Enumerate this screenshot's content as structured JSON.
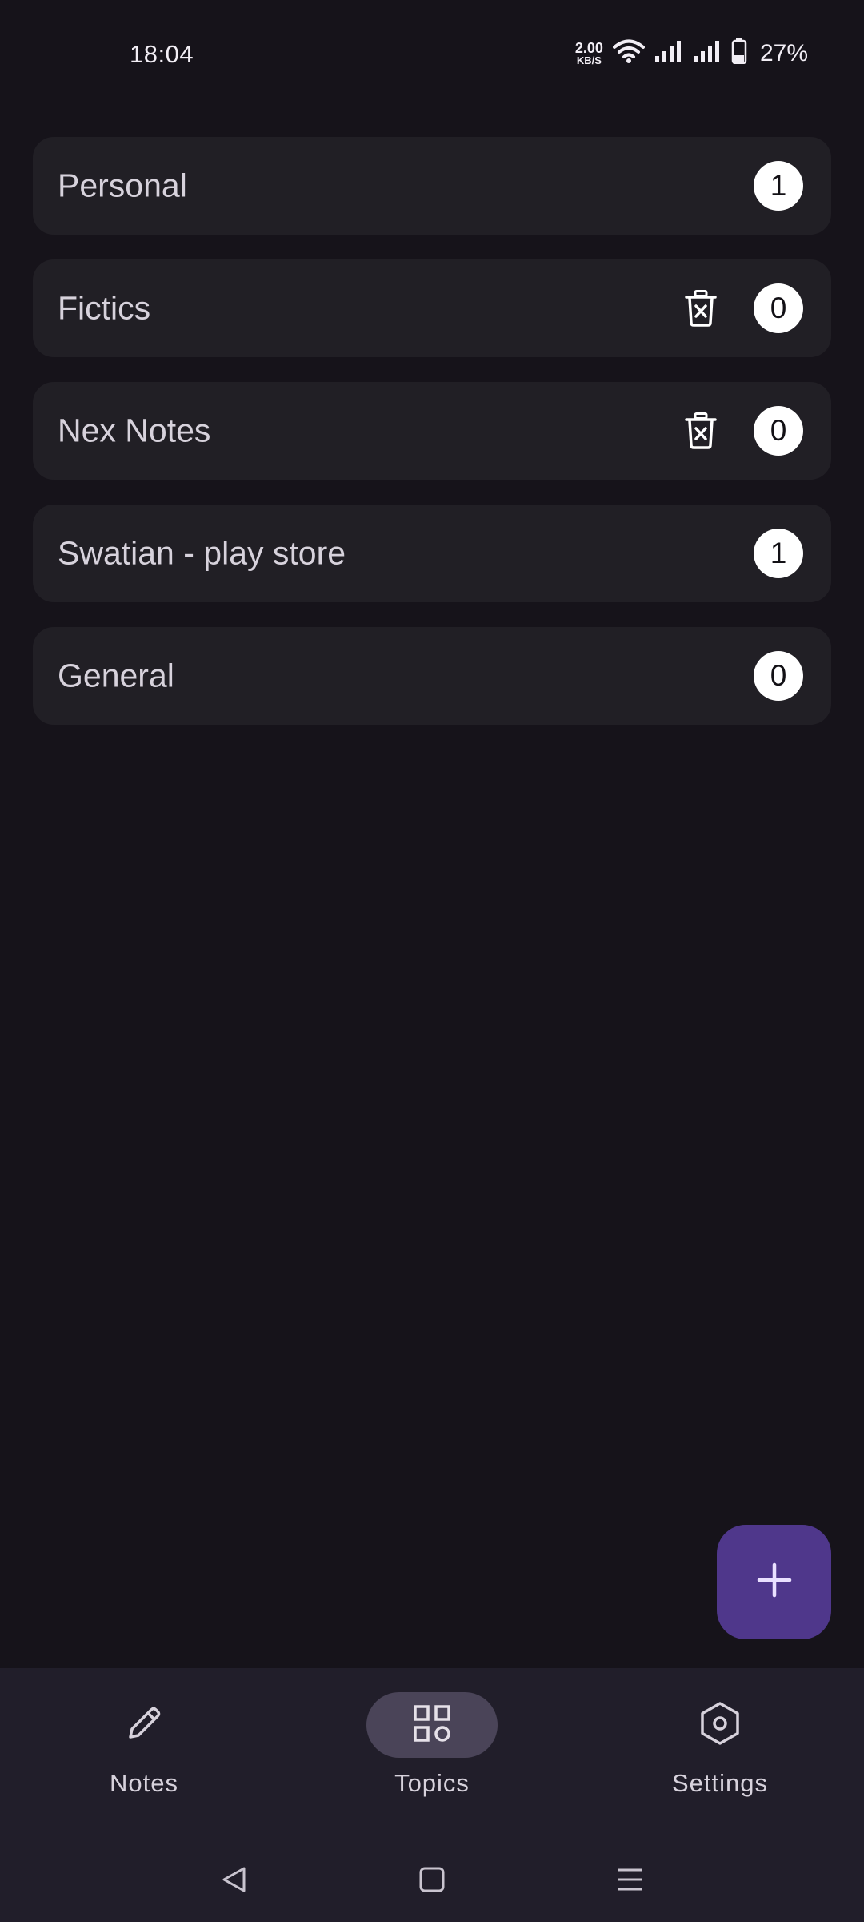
{
  "status_bar": {
    "time": "18:04",
    "net_speed_value": "2.00",
    "net_speed_unit": "KB/S",
    "battery_percent": "27%"
  },
  "topics": [
    {
      "name": "Personal",
      "count": "1",
      "deletable": false
    },
    {
      "name": "Fictics",
      "count": "0",
      "deletable": true
    },
    {
      "name": "Nex Notes",
      "count": "0",
      "deletable": true
    },
    {
      "name": "Swatian - play store",
      "count": "1",
      "deletable": false
    },
    {
      "name": "General",
      "count": "0",
      "deletable": false
    }
  ],
  "fab": {
    "icon": "plus-icon"
  },
  "bottom_nav": {
    "items": [
      {
        "label": "Notes",
        "icon": "pencil-icon",
        "active": false
      },
      {
        "label": "Topics",
        "icon": "grid-icon",
        "active": true
      },
      {
        "label": "Settings",
        "icon": "hexagon-settings-icon",
        "active": false
      }
    ]
  },
  "system_nav": {
    "back": "back-icon",
    "home": "home-icon",
    "menu": "menu-icon"
  },
  "colors": {
    "background": "#16131a",
    "card": "#211f25",
    "fab": "#4f378b",
    "nav_bar": "#211e2a",
    "nav_active_pill": "#4a4458"
  }
}
